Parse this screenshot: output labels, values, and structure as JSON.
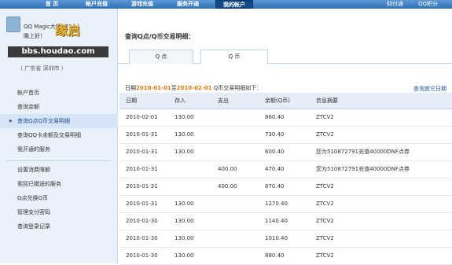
{
  "topnav": {
    "tabs": [
      "首 页",
      "帐户充值",
      "游戏充值",
      "服务开通",
      "我的帐户"
    ],
    "right_links": [
      "财付通",
      "QQ积分"
    ]
  },
  "sidebar": {
    "username": "QQ Magic大师 (21...)",
    "greeting": "晚上好！",
    "watermark_logo": "缘启",
    "watermark_url": "bbs.houdao.com",
    "location": "（ 广东省 深圳市 ）",
    "menu_groups": [
      [
        "帐户首页",
        "查询余额",
        "查询Q点Q币交易明细",
        "查询QQ卡余额及交易明细",
        "我开通的服务"
      ],
      [
        "设置消费限额",
        "索回已赠送的服务",
        "Q点兑换Q币",
        "管理支付密码",
        "查询登录记录"
      ]
    ],
    "active_item": "查询Q点Q币交易明细"
  },
  "main": {
    "title": "查询Q点/Q币交易明细：",
    "tabs": [
      "Q 点",
      "Q 币"
    ],
    "active_tab": "Q 币",
    "range": {
      "prefix": "日期",
      "start": "2010-01-01",
      "mid": "至",
      "end": "2010-02-01",
      "suffix": "Q币交易明细如下："
    },
    "other_date_link": "查询其它日期",
    "table": {
      "headers": [
        "日期",
        "存入",
        "支出",
        "余额(Q币)",
        "信息摘要"
      ],
      "rows": [
        [
          "2010-02-01",
          "130.00",
          "",
          "860.40",
          "ZTCV2"
        ],
        [
          "2010-01-31",
          "130.00",
          "",
          "730.40",
          "ZTCV2"
        ],
        [
          "2010-01-31",
          "130.00",
          "",
          "600.40",
          "您为510872791充值40000DNF点券"
        ],
        [
          "2010-01-31",
          "",
          "400.00",
          "470.40",
          "您为510872791充值40000DNF点券"
        ],
        [
          "2010-01-31",
          "",
          "400.00",
          "870.40",
          "ZTCV2"
        ],
        [
          "2010-01-31",
          "130.00",
          "",
          "1270.40",
          "ZTCV2"
        ],
        [
          "2010-01-30",
          "130.00",
          "",
          "1140.40",
          "ZTCV2"
        ],
        [
          "2010-01-30",
          "130.00",
          "",
          "1010.40",
          "ZTCV2"
        ],
        [
          "2010-01-30",
          "130.00",
          "",
          "880.40",
          "ZTCV2"
        ]
      ]
    }
  },
  "colors": {
    "nav_blue": "#2f6fb3",
    "date_orange": "#e07a0b",
    "link_blue": "#1c4f96"
  }
}
